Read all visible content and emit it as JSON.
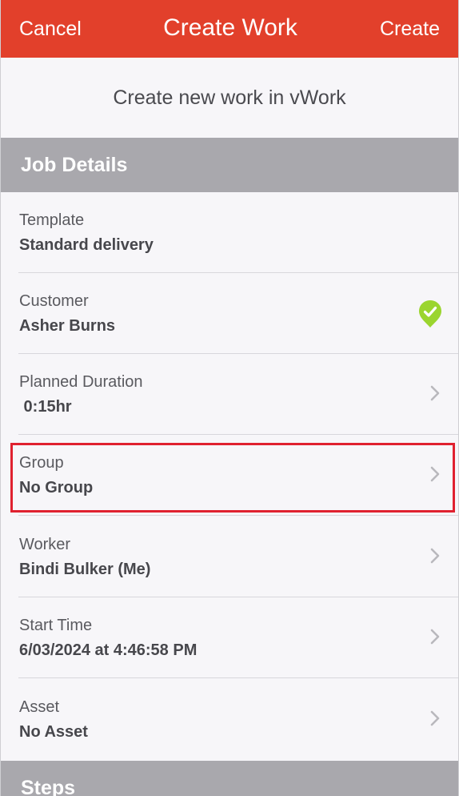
{
  "navbar": {
    "cancel_label": "Cancel",
    "title": "Create Work",
    "create_label": "Create",
    "color": "#e2402b"
  },
  "subtitle": "Create new work in vWork",
  "job_details": {
    "header": "Job Details",
    "rows": [
      {
        "label": "Template",
        "value": "Standard delivery"
      },
      {
        "label": "Customer",
        "value": "Asher Burns",
        "icon": "check-badge-icon",
        "icon_color": "#9bd52f"
      },
      {
        "label": "Planned Duration",
        "value": " 0:15hr",
        "icon": "chevron-right-icon"
      },
      {
        "label": "Group",
        "value": "No Group",
        "icon": "chevron-right-icon",
        "highlighted": true,
        "highlight_color": "#e0212f"
      },
      {
        "label": "Worker",
        "value": "Bindi Bulker (Me)",
        "icon": "chevron-right-icon"
      },
      {
        "label": "Start Time",
        "value": "6/03/2024 at 4:46:58 PM",
        "icon": "chevron-right-icon"
      },
      {
        "label": "Asset",
        "value": "No Asset",
        "icon": "chevron-right-icon"
      }
    ]
  },
  "steps": {
    "header": "Steps"
  }
}
